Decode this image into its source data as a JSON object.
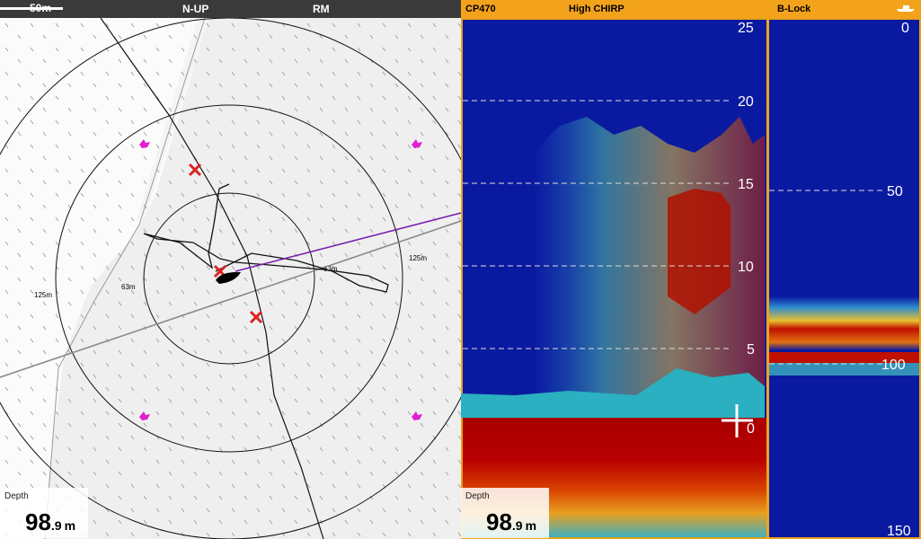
{
  "chart": {
    "scale_bar": "50m",
    "orientation": "N-UP",
    "motion_mode": "RM",
    "ring_labels": {
      "inner": "63m",
      "outer": "125m"
    },
    "depth": {
      "label": "Depth",
      "int": "98",
      "dec": ".9",
      "unit": "m"
    }
  },
  "sonar": {
    "source": "CP470",
    "frequency": "High CHIRP",
    "bottom_lock": "B-Lock",
    "main_scale": [
      "25",
      "20",
      "15",
      "10",
      "5",
      "0"
    ],
    "lock_scale": [
      "0",
      "50",
      "100",
      "150"
    ],
    "depth": {
      "label": "Depth",
      "int": "98",
      "dec": ".9",
      "unit": "m"
    }
  },
  "colors": {
    "sonar_background": "#0a1aa0",
    "bottom_echo": "#a80000",
    "accent_bar": "#f3a31b",
    "waypoint": "#dd2222",
    "heading_line": "#7a1fb0"
  }
}
